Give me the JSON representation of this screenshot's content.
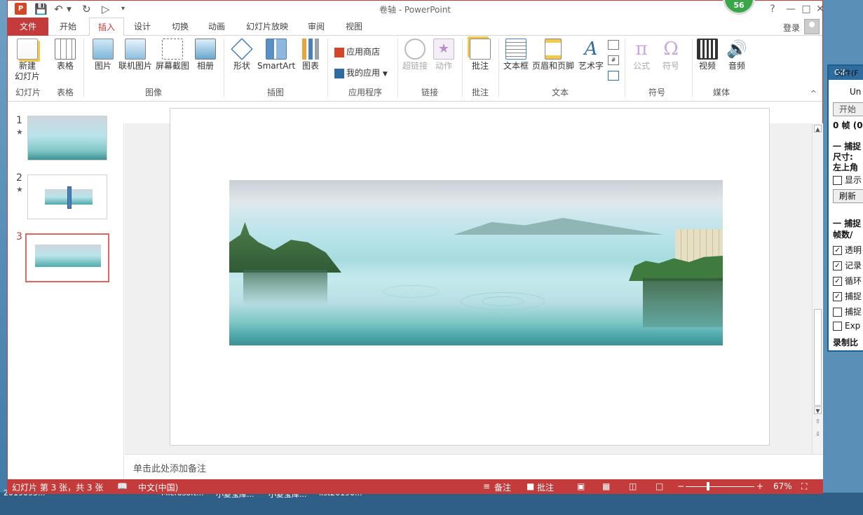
{
  "window": {
    "title": "卷轴 - PowerPoint",
    "badge": "56",
    "login": "登录"
  },
  "tabs": [
    "文件",
    "开始",
    "插入",
    "设计",
    "切换",
    "动画",
    "幻灯片放映",
    "审阅",
    "视图"
  ],
  "active_tab": "插入",
  "ribbon": {
    "new_slide": [
      "新建",
      "幻灯片"
    ],
    "table": "表格",
    "picture": "图片",
    "online_picture": "联机图片",
    "screenshot": "屏幕截图",
    "album": "相册",
    "shapes": "形状",
    "smartart": "SmartArt",
    "chart": "图表",
    "app_store": "应用商店",
    "my_apps": "我的应用",
    "hyperlink": "超链接",
    "action": "动作",
    "comment": "批注",
    "textbox": "文本框",
    "header_footer": "页眉和页脚",
    "wordart": "艺术字",
    "equation": "公式",
    "symbol": "符号",
    "video": "视频",
    "audio": "音频",
    "groups": {
      "slides": "幻灯片",
      "tables": "表格",
      "images": "图像",
      "illustrations": "插图",
      "apps": "应用程序",
      "links": "链接",
      "comments": "批注",
      "text": "文本",
      "symbols": "符号",
      "media": "媒体"
    }
  },
  "thumbnails": [
    {
      "num": "1",
      "star": "★"
    },
    {
      "num": "2",
      "star": "★"
    },
    {
      "num": "3",
      "star": ""
    }
  ],
  "notes_placeholder": "单击此处添加备注",
  "status": {
    "slide_info": "幻灯片 第 3 张，共 3 张",
    "language": "中文(中国)",
    "notes": "备注",
    "comments": "批注",
    "zoom": "67%",
    "zoom_level": 0.33
  },
  "gif_tool": {
    "title": "Gif-",
    "menu": "文件(F",
    "undo": "Un",
    "start": "开始",
    "frames": "0 帧 (0",
    "capture1": "一 捕捉",
    "size": "尺寸:",
    "top_left": "左上角",
    "show": "显示",
    "refresh": "刷新",
    "capture2": "一 捕捉",
    "fps": "帧数/",
    "opt1": "透明",
    "opt2": "记录",
    "opt3": "循环",
    "opt4": "捕捉",
    "opt5": "捕捉",
    "opt6": "Exp",
    "ratio": "录制比"
  },
  "taskbar": [
    "2019095...",
    "Microsoft...",
    "小菱宝库...",
    "小菱宝库...",
    "list20190..."
  ],
  "colors": {
    "accent": "#c43b3b",
    "gif_title": "#2f6da0"
  }
}
